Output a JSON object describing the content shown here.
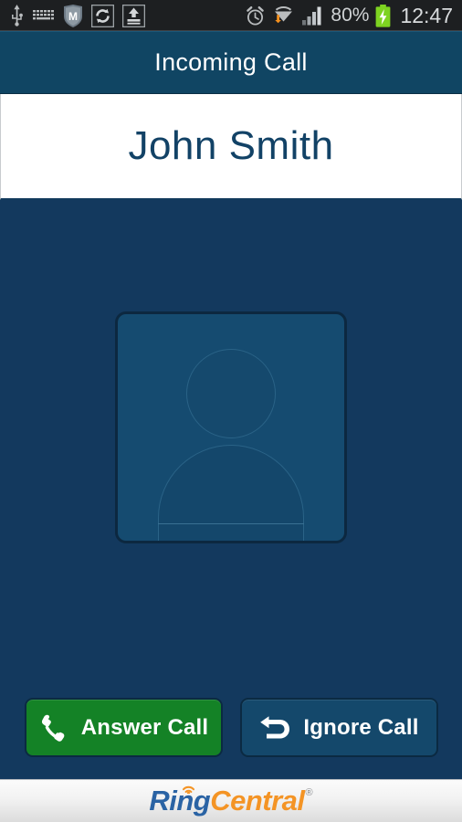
{
  "status_bar": {
    "left_icons": [
      {
        "name": "usb-icon",
        "label": "USB"
      },
      {
        "name": "keyboard-icon",
        "label": "Keyboard"
      },
      {
        "name": "mcafee-shield-icon",
        "label": "M"
      },
      {
        "name": "sync-icon",
        "label": "Sync"
      },
      {
        "name": "upload-icon",
        "label": "Upload"
      }
    ],
    "right_icons": [
      {
        "name": "alarm-clock-icon",
        "label": "Alarm"
      },
      {
        "name": "wifi-download-icon",
        "label": "Wi-Fi"
      },
      {
        "name": "cellular-signal-icon",
        "label": "Signal"
      }
    ],
    "battery_percent": "80%",
    "battery_state": "charging",
    "clock": "12:47"
  },
  "titlebar": {
    "title": "Incoming Call"
  },
  "caller": {
    "name": "John Smith",
    "avatar_alt": "contact-placeholder"
  },
  "actions": {
    "answer": {
      "label": "Answer Call",
      "icon": "phone-handset-icon",
      "color": "#148226"
    },
    "ignore": {
      "label": "Ignore Call",
      "icon": "undo-arrow-icon",
      "color": "#14486b"
    }
  },
  "footer": {
    "brand_first": "Ring",
    "brand_second": "Central",
    "registered_mark": "®",
    "brand_color_first": "#2a63a4",
    "brand_color_second": "#f49425"
  },
  "theme": {
    "title_bar_bg": "#104563",
    "body_bg": "#13395e",
    "name_text_color": "#124266",
    "status_bar_bg": "#1d1f21"
  }
}
